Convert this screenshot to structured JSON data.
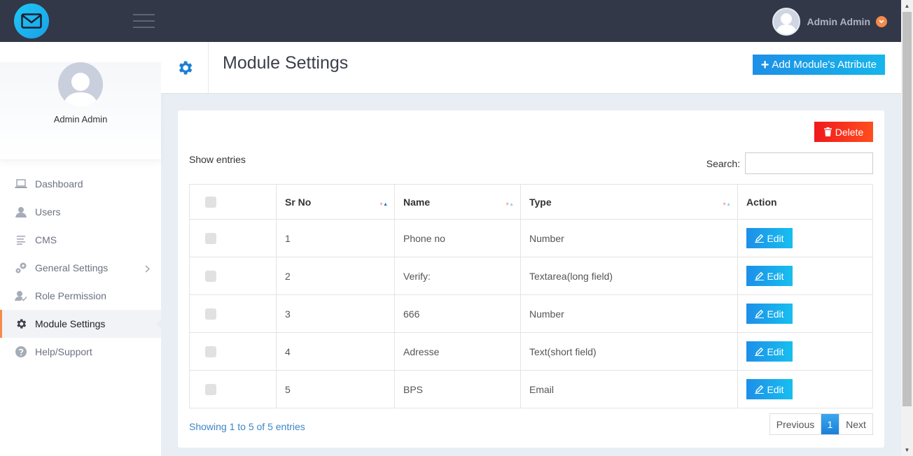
{
  "app": {
    "user_name": "Admin Admin"
  },
  "sidebar": {
    "profile_name": "Admin Admin",
    "items": [
      {
        "label": "Dashboard",
        "icon": "laptop-icon"
      },
      {
        "label": "Users",
        "icon": "user-icon"
      },
      {
        "label": "CMS",
        "icon": "document-lines-icon"
      },
      {
        "label": "General Settings",
        "icon": "gears-icon"
      },
      {
        "label": "Role Permission",
        "icon": "user-check-icon"
      },
      {
        "label": "Module Settings",
        "icon": "gear-icon",
        "active": true
      },
      {
        "label": "Help/Support",
        "icon": "question-icon"
      }
    ]
  },
  "header": {
    "title": "Module Settings",
    "add_button_label": "Add Module's Attribute"
  },
  "toolbar": {
    "delete_label": "Delete",
    "show_entries_label": "Show entries",
    "search_label": "Search:",
    "search_value": ""
  },
  "table": {
    "columns": [
      "Sr No",
      "Name",
      "Type",
      "Action"
    ],
    "rows": [
      {
        "sr": "1",
        "name": "Phone no",
        "type": "Number",
        "action": "Edit"
      },
      {
        "sr": "2",
        "name": "Verify:",
        "type": "Textarea(long field)",
        "action": "Edit"
      },
      {
        "sr": "3",
        "name": "666",
        "type": "Number",
        "action": "Edit"
      },
      {
        "sr": "4",
        "name": "Adresse",
        "type": "Text(short field)",
        "action": "Edit"
      },
      {
        "sr": "5",
        "name": "BPS",
        "type": "Email",
        "action": "Edit"
      }
    ]
  },
  "footer": {
    "info": "Showing 1 to 5 of 5 entries",
    "previous_label": "Previous",
    "current_page": "1",
    "next_label": "Next"
  },
  "colors": {
    "topbar": "#323848",
    "accent_blue": "#1d8fe8",
    "accent_orange": "#f58a4b",
    "delete_red": "#f0191d"
  }
}
